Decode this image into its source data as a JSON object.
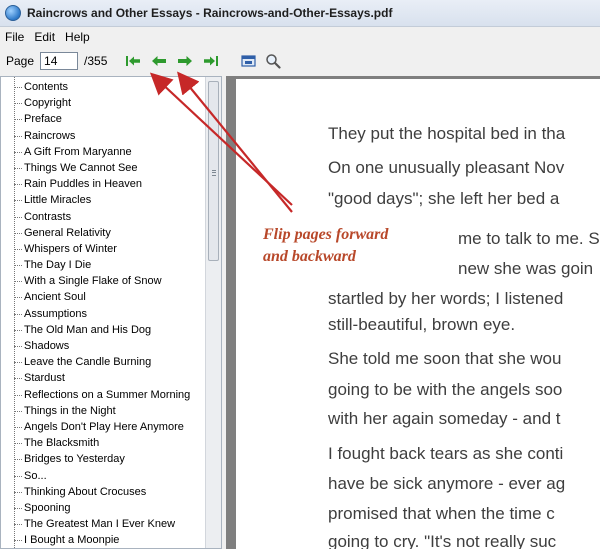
{
  "window": {
    "title": "Raincrows and Other Essays - Raincrows-and-Other-Essays.pdf"
  },
  "menu": [
    {
      "label": "File"
    },
    {
      "label": "Edit"
    },
    {
      "label": "Help"
    }
  ],
  "toolbar": {
    "page_label": "Page",
    "current_page": "14",
    "total_pages": "/355"
  },
  "toc": [
    "Contents",
    "Copyright",
    "Preface",
    "Raincrows",
    "A Gift From Maryanne",
    "Things We Cannot See",
    "Rain Puddles in Heaven",
    "Little Miracles",
    "Contrasts",
    "General Relativity",
    "Whispers of Winter",
    "The Day I Die",
    "With a Single Flake of Snow",
    "Ancient Soul",
    "Assumptions",
    "The Old Man and His Dog",
    "Shadows",
    "Leave the Candle Burning",
    "Stardust",
    "Reflections on a Summer Morning",
    "Things in the Night",
    "Angels Don't Play Here Anymore",
    "The Blacksmith",
    "Bridges to Yesterday",
    "So...",
    "Thinking About Crocuses",
    "Spooning",
    "The Greatest Man I Ever Knew",
    "I Bought a Moonpie"
  ],
  "page_text": [
    "They put the hospital bed in tha",
    "On one unusually pleasant Nov",
    "\"good days\"; she left her bed a",
    "me to talk to me. S",
    "new she was goin",
    "startled by her words; I listened",
    "still-beautiful, brown eye.",
    "She told me soon that she wou",
    "going to be with the angels soo",
    "with her again someday - and t",
    "I fought back tears as she conti",
    "have be sick anymore - ever ag",
    "promised that when the time c",
    "going to cry. \"It's not really suc"
  ],
  "annotation": {
    "line1": "Flip pages forward",
    "line2": "and backward"
  },
  "colors": {
    "annotation": "#b8482a",
    "arrow": "#c62828",
    "nav_green": "#2e9a2e"
  }
}
